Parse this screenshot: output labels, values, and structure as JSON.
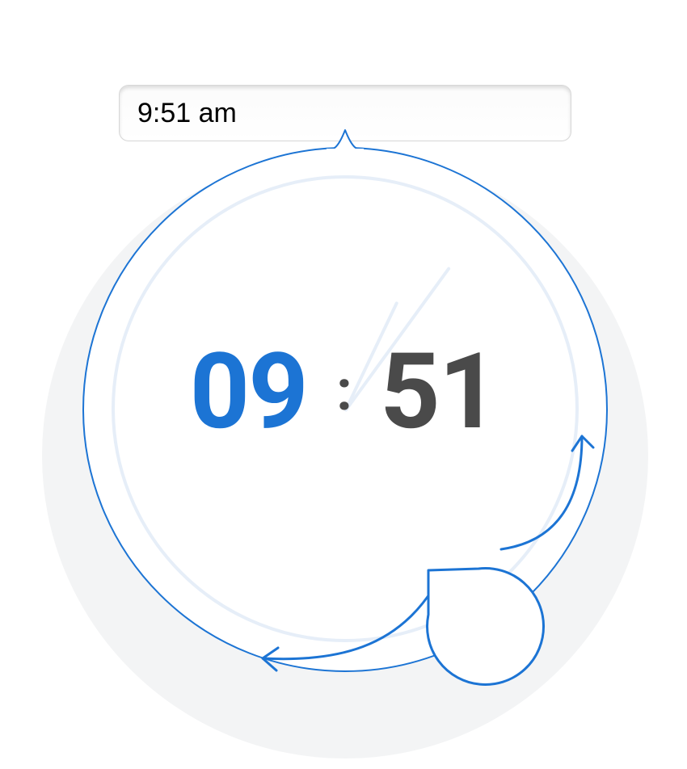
{
  "colors": {
    "accent": "#1c74d4",
    "accent_light": "#e6eef8",
    "digit_dark": "#4a4a4a",
    "bg_ring": "#f3f4f5",
    "input_border": "#d7d7d7"
  },
  "time": {
    "input_value": "9:51 am",
    "hours_padded": "09",
    "minutes_padded": "51",
    "separator": ":",
    "hour_hand_angle_deg": -64.5,
    "minute_hand_angle_deg": -54,
    "ampm": "am"
  }
}
